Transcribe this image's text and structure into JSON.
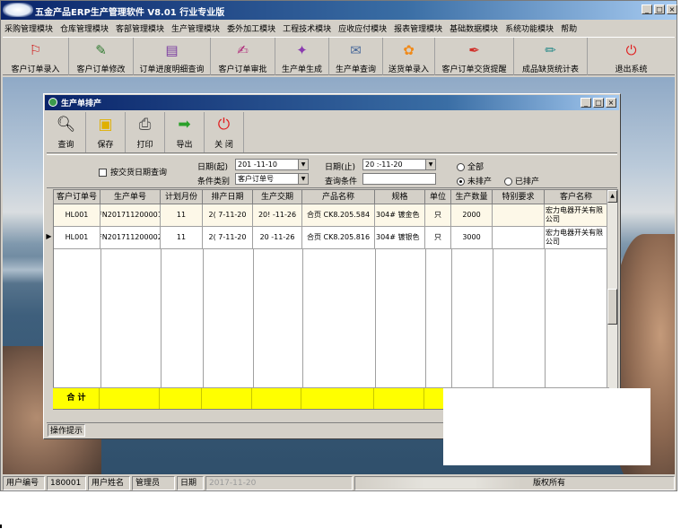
{
  "app": {
    "title": "五金产品ERP生产管理软件  V8.01 行业专业版",
    "window_buttons": [
      "_",
      "□",
      "×"
    ]
  },
  "menu": [
    "采购管理模块",
    "仓库管理模块",
    "客部管理模块",
    "生产管理模块",
    "委外加工模块",
    "工程技术模块",
    "应收应付模块",
    "报表管理模块",
    "基础数据模块",
    "系统功能模块",
    "帮助"
  ],
  "toolbar": [
    {
      "label": "客户订单录入",
      "icon": "pdf-document-icon"
    },
    {
      "label": "客户订单修改",
      "icon": "edit-document-icon"
    },
    {
      "label": "订单进度明细查询",
      "icon": "query-document-icon"
    },
    {
      "label": "客户订单审批",
      "icon": "approve-icon"
    },
    {
      "label": "生产单生成",
      "icon": "generate-icon"
    },
    {
      "label": "生产单查询",
      "icon": "search-document-icon"
    },
    {
      "label": "送货单录入",
      "icon": "flower-icon"
    },
    {
      "label": "客户订单交货提醒",
      "icon": "reminder-icon"
    },
    {
      "label": "成品缺货统计表",
      "icon": "stats-pen-icon"
    },
    {
      "label": "退出系统",
      "icon": "exit-icon"
    }
  ],
  "child_window": {
    "title": "生产单排产",
    "window_buttons": [
      "_",
      "□",
      "×"
    ],
    "toolbar": [
      {
        "label": "查询",
        "icon": "magnifier-icon"
      },
      {
        "label": "保存",
        "icon": "floppy-disk-icon"
      },
      {
        "label": "打印",
        "icon": "printer-icon"
      },
      {
        "label": "导出",
        "icon": "arrow-right-icon"
      },
      {
        "label": "关 闭",
        "icon": "power-icon"
      }
    ],
    "filter": {
      "delivery_date_query": "按交货日期查询",
      "date_start_label": "日期(起)",
      "date_start_value": "201 -11-10",
      "date_end_label": "日期(止)",
      "date_end_value": "20 :-11-20",
      "condition_type_label": "条件类别",
      "condition_type_value": "客户订单号",
      "query_condition_label": "查询条件",
      "query_condition_value": "",
      "radio_all": "全部",
      "radio_unscheduled": "未排产",
      "radio_scheduled": "已排产",
      "selected": "未排产"
    },
    "columns": [
      "客户订单号",
      "生产单号",
      "计划月份",
      "排产日期",
      "生产交期",
      "产品名称",
      "规格",
      "单位",
      "生产数量",
      "特别要求",
      "客户名称"
    ],
    "rows": [
      [
        "HL001",
        "FN201711200001",
        "11",
        "2(  7-11-20",
        "20!  -11-26",
        "合页 CK8.205.584",
        "304# 镀金色",
        "只",
        "2000",
        "",
        "宏力电器开关有限公司"
      ],
      [
        "HL001",
        "FN201711200002",
        "11",
        "2(  7-11-20",
        "20   -11-26",
        "合页 CK8.205.816",
        "304# 镀银色",
        "只",
        "3000",
        "",
        "宏力电器开关有限公司"
      ]
    ],
    "current_row_marker": "▶",
    "sum_label": "合 计",
    "tip_label": "操作提示"
  },
  "statusbar": {
    "user_id_label": "用户编号",
    "user_id_value": "180001",
    "user_name_label": "用户姓名",
    "user_name_value": "管理员",
    "date_label": "日期",
    "date_value": "2017-11-20",
    "copyright": "版权所有"
  },
  "colors": {
    "titlebar": "#0a246a",
    "window_face": "#d4d0c8",
    "sum_row": "#ffff00",
    "selected_row": "#fdf8e8"
  }
}
